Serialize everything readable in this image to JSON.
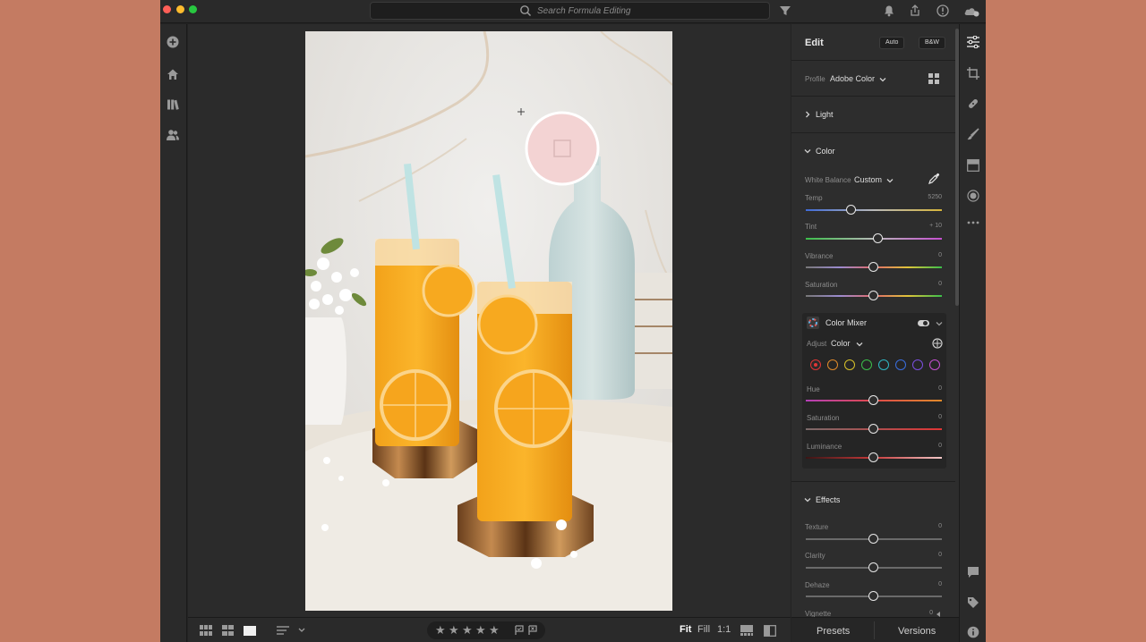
{
  "titlebar": {
    "search_placeholder": "Search Formula Editing"
  },
  "left_rail": {
    "icons": [
      "add-photo-icon",
      "home-icon",
      "library-icon",
      "people-icon"
    ]
  },
  "bottom_bar": {
    "zoom": {
      "fit": "Fit",
      "fill": "Fill",
      "one_to_one": "1:1",
      "active": "Fit"
    },
    "rating_stars": 5
  },
  "panel": {
    "title": "Edit",
    "auto_label": "Auto",
    "bw_label": "B&W",
    "profile_label": "Profile",
    "profile_value": "Adobe Color",
    "light": {
      "label": "Light",
      "expanded": false
    },
    "color": {
      "label": "Color",
      "expanded": true,
      "white_balance_label": "White Balance",
      "white_balance_value": "Custom",
      "sliders": [
        {
          "label": "Temp",
          "value": "5250",
          "position": 0.33
        },
        {
          "label": "Tint",
          "value": "+ 10",
          "position": 0.53
        },
        {
          "label": "Vibrance",
          "value": "0",
          "position": 0.5
        },
        {
          "label": "Saturation",
          "value": "0",
          "position": 0.5
        }
      ]
    },
    "color_mixer": {
      "label": "Color Mixer",
      "adjust_label": "Adjust",
      "adjust_value": "Color",
      "swatch_colors": [
        "#e03535",
        "#e08a2a",
        "#d8c22a",
        "#3bbf4a",
        "#2fb8c4",
        "#3a6ee0",
        "#7b4fe0",
        "#c54fd0"
      ],
      "selected_swatch": 0,
      "sliders": [
        {
          "label": "Hue",
          "value": "0",
          "position": 0.5
        },
        {
          "label": "Saturation",
          "value": "0",
          "position": 0.5
        },
        {
          "label": "Luminance",
          "value": "0",
          "position": 0.5
        }
      ]
    },
    "effects": {
      "label": "Effects",
      "expanded": true,
      "sliders": [
        {
          "label": "Texture",
          "value": "0",
          "position": 0.5
        },
        {
          "label": "Clarity",
          "value": "0",
          "position": 0.5
        },
        {
          "label": "Dehaze",
          "value": "0",
          "position": 0.5
        },
        {
          "label": "Vignette",
          "value": "0"
        }
      ]
    }
  },
  "panel_footer": {
    "presets": "Presets",
    "versions": "Versions"
  },
  "right_rail": {
    "icons": [
      "edit-sliders-icon",
      "crop-icon",
      "healing-icon",
      "brush-icon",
      "gradient-icon",
      "radial-icon",
      "more-icon",
      "comment-icon",
      "tag-icon",
      "info-icon"
    ]
  }
}
